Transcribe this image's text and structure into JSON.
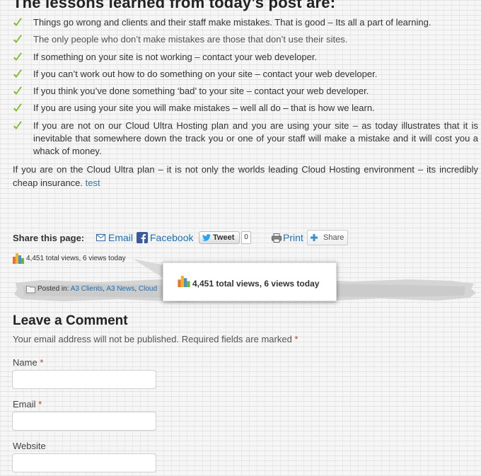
{
  "post": {
    "heading": "The lessons learned from today’s post are:",
    "lessons": [
      "Things go wrong and clients and their staff  make mistakes. That is good – Its all a part of learning.",
      "The only people who don’t make mistakes are those that don’t use their sites.",
      "If something on your site is not working – contact your web developer.",
      "If you can’t work out how to do something on your site – contact your web developer.",
      "If you think you’ve done something ‘bad’ to your site – contact your web developer.",
      "If you are using your site you will make mistakes – well all do – that is how we learn.",
      "If you are not on our Cloud Ultra Hosting plan and you are using your site  – as today illustrates that it is inevitable that somewhere down the track you or one of your staff will make a mistake and it will cost you a whack of money."
    ],
    "closing_text": "If you are on the Cloud Ultra plan – it is not only the worlds leading Cloud Hosting environment – its incredibly cheap insurance.",
    "closing_link": "test"
  },
  "share": {
    "label": "Share this page:",
    "email": "Email",
    "facebook": "Facebook",
    "tweet": "Tweet",
    "tweet_count": "0",
    "print": "Print",
    "share": "Share"
  },
  "stats": {
    "views_text": "4,451 total views, 6 views today"
  },
  "posted_in": {
    "label": "Posted in:",
    "categories": [
      "A3 Clients",
      "A3 News",
      "Cloud"
    ]
  },
  "comment_form": {
    "title": "Leave a Comment",
    "note": "Your email address will not be published. Required fields are marked",
    "required_mark": "*",
    "name_label": "Name",
    "email_label": "Email",
    "website_label": "Website"
  },
  "colors": {
    "check": "#7cbf2a",
    "link": "#1f6fae",
    "required": "#c0392b"
  }
}
